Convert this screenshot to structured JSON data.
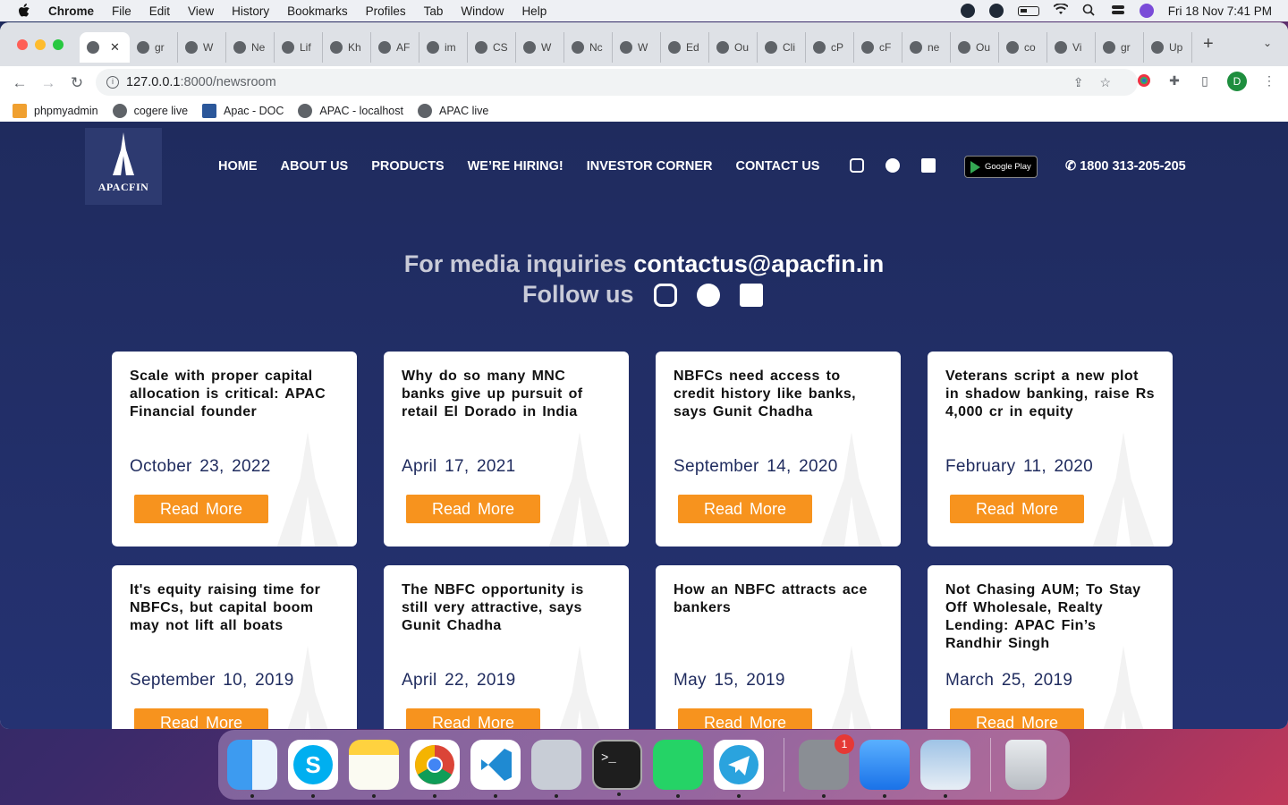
{
  "menubar": {
    "app": "Chrome",
    "items": [
      "File",
      "Edit",
      "View",
      "History",
      "Bookmarks",
      "Profiles",
      "Tab",
      "Window",
      "Help"
    ],
    "clock": "Fri 18 Nov  7:41 PM"
  },
  "tabs": [
    "gr",
    "W",
    "Ne",
    "Lif",
    "Kh",
    "AF",
    "im",
    "CS",
    "W",
    "Nc",
    "W",
    "Ed",
    "Ou",
    "Cli",
    "cP",
    "cF",
    "ne",
    "Ou",
    "co",
    "Vi",
    "gr",
    "Up"
  ],
  "address": {
    "host": "127.0.0.1",
    "path": ":8000/newsroom"
  },
  "profile_initial": "D",
  "bookmarks": [
    "phpmyadmin",
    "cogere live",
    "Apac - DOC",
    "APAC - localhost",
    "APAC live"
  ],
  "site": {
    "logo_text": "APACFIN",
    "nav": [
      "HOME",
      "ABOUT US",
      "PRODUCTS",
      "WE’RE HIRING!",
      "INVESTOR CORNER",
      "CONTACT US"
    ],
    "gplay_label": "Google Play",
    "phone": "1800 313-205-205",
    "media_label": "For media inquiries",
    "media_email": "contactus@apacfin.in",
    "follow_label": "Follow us",
    "cards": [
      {
        "title": "Scale with proper capital allocation is critical: APAC Financial founder",
        "date": "October 23, 2022",
        "button": "Read More"
      },
      {
        "title": "Why do so many MNC banks give up pursuit of retail El Dorado in India",
        "date": "April 17, 2021",
        "button": "Read More"
      },
      {
        "title": "NBFCs need access to credit history like banks, says Gunit Chadha",
        "date": "September 14, 2020",
        "button": "Read More"
      },
      {
        "title": "Veterans script a new plot in shadow banking, raise Rs 4,000 cr in equity",
        "date": "February 11, 2020",
        "button": "Read More"
      },
      {
        "title": "It's equity raising time for NBFCs, but capital boom may not lift all boats",
        "date": "September 10, 2019",
        "button": "Read More"
      },
      {
        "title": "The NBFC opportunity is still very attractive, says Gunit Chadha",
        "date": "April 22, 2019",
        "button": "Read More"
      },
      {
        "title": "How an NBFC attracts ace bankers",
        "date": "May 15, 2019",
        "button": "Read More"
      },
      {
        "title": "Not Chasing AUM; To Stay Off Wholesale, Realty Lending: APAC Fin’s Randhir Singh",
        "date": "March 25, 2019",
        "button": "Read More"
      }
    ]
  },
  "dock": {
    "apps": [
      "finder",
      "skype",
      "notes",
      "chrome",
      "vscode",
      "system-utility",
      "terminal",
      "whatsapp",
      "telegram",
      "system-preferences",
      "mail",
      "preview",
      "trash"
    ],
    "notification_badge": "1"
  }
}
